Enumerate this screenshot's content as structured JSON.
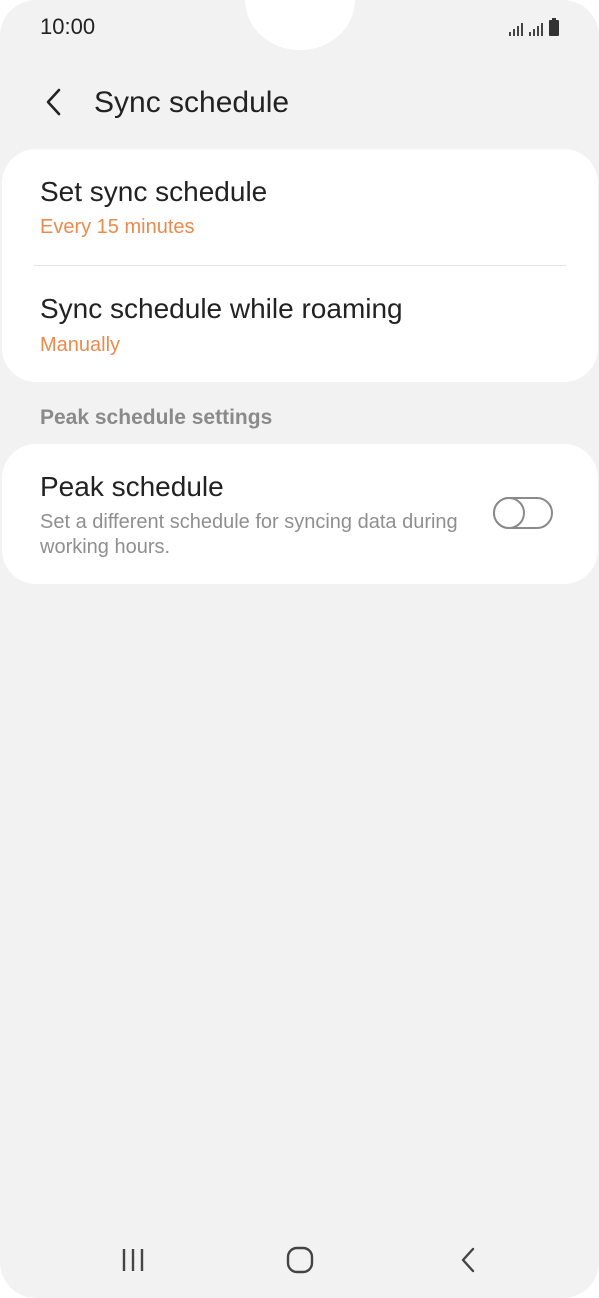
{
  "status_bar": {
    "time": "10:00",
    "icons": [
      "signal-icon",
      "signal-icon",
      "battery-icon"
    ]
  },
  "header": {
    "title": "Sync schedule",
    "back_icon": "chevron-left-icon"
  },
  "sync_card": {
    "items": [
      {
        "title": "Set sync schedule",
        "value": "Every 15 minutes"
      },
      {
        "title": "Sync schedule while roaming",
        "value": "Manually"
      }
    ]
  },
  "peak_section": {
    "header": "Peak schedule settings",
    "title": "Peak schedule",
    "description": "Set a different schedule for syncing data during working hours.",
    "toggle_on": false
  },
  "nav_bar": {
    "buttons": [
      "recent-apps-icon",
      "home-icon",
      "back-icon"
    ]
  },
  "colors": {
    "accent": "#ec8a4d",
    "background": "#f2f2f2",
    "card": "#ffffff"
  }
}
